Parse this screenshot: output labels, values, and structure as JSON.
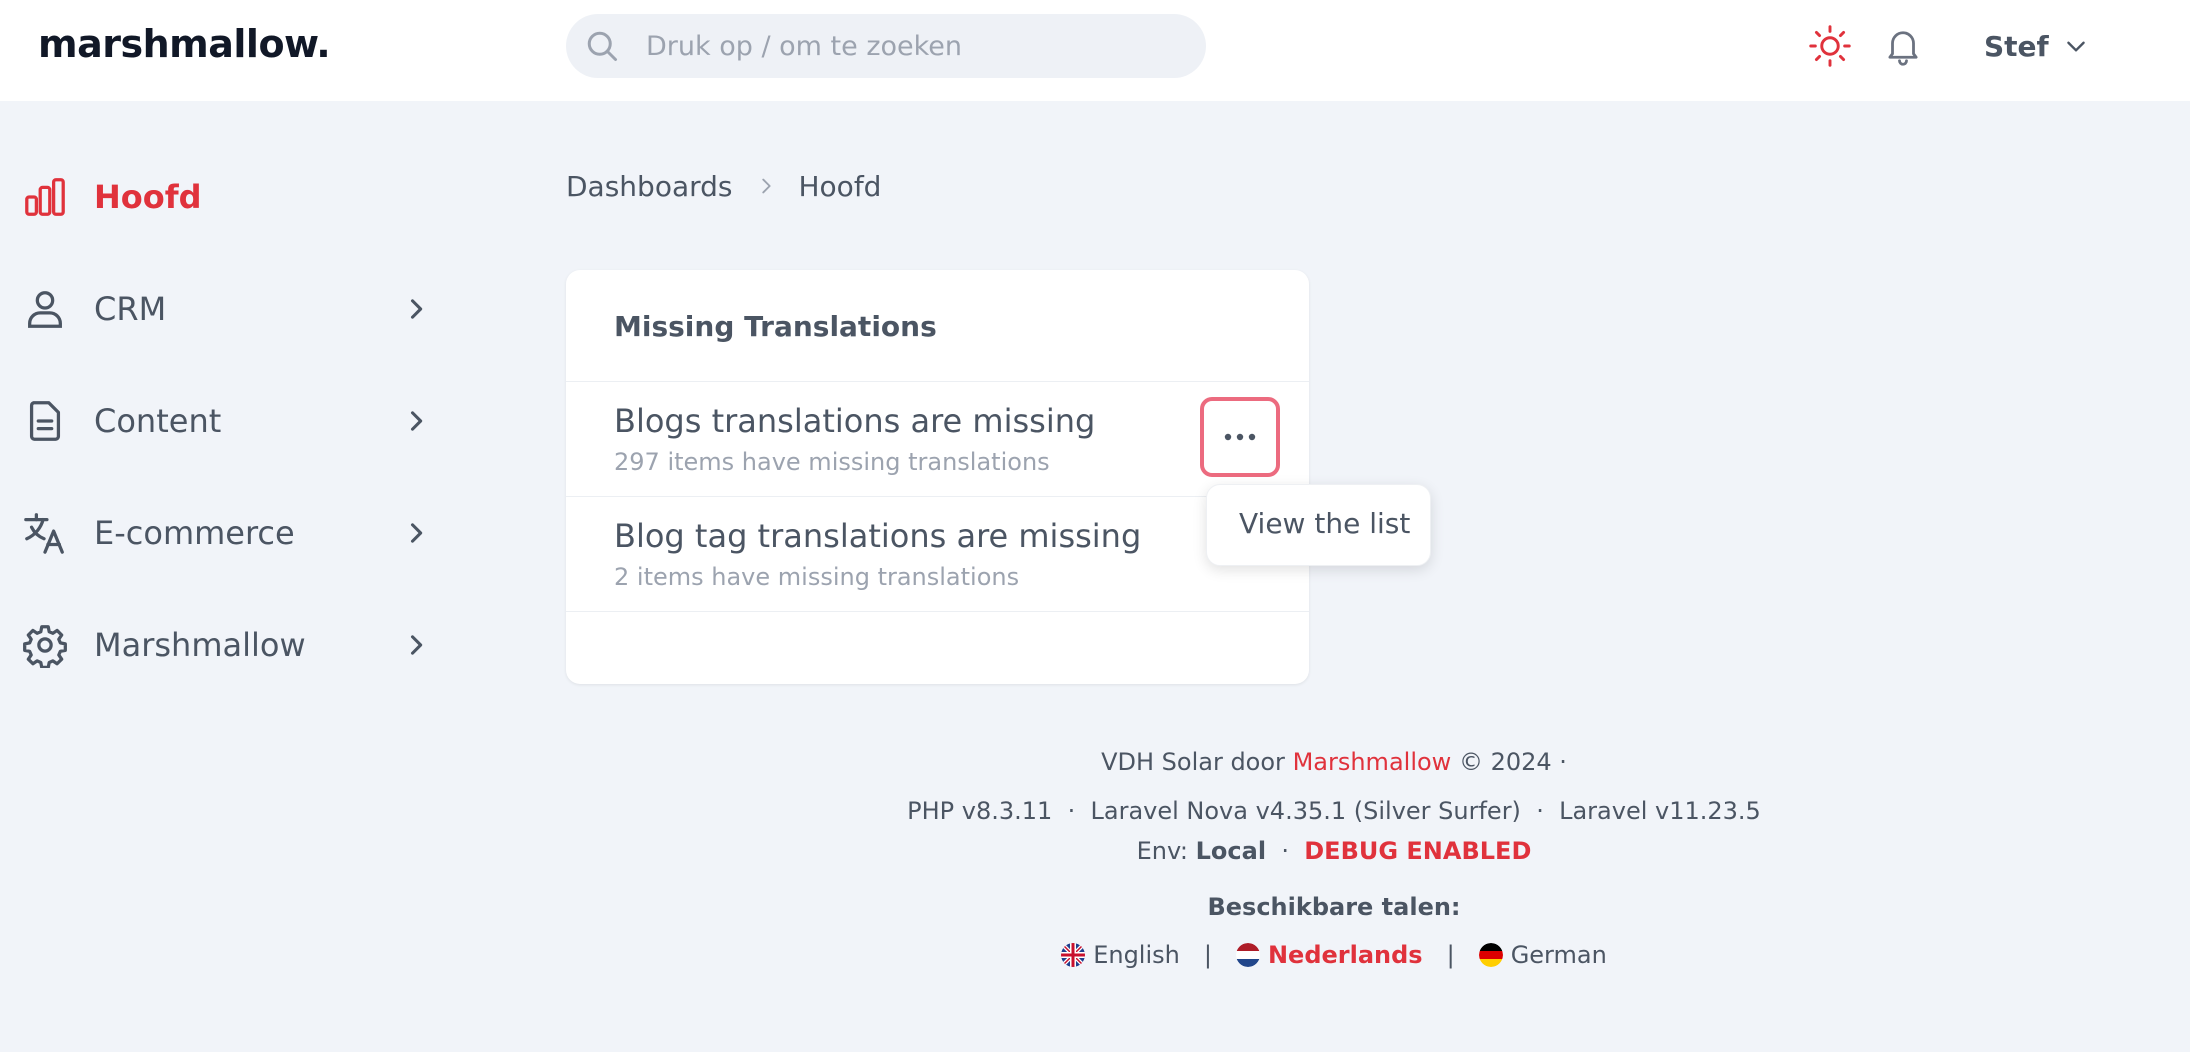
{
  "header": {
    "logo": "marshmallow.",
    "search_placeholder": "Druk op / om te zoeken",
    "user_name": "Stef"
  },
  "sidebar": {
    "items": [
      {
        "label": "Hoofd",
        "icon": "bar-chart-icon",
        "active": true
      },
      {
        "label": "CRM",
        "icon": "user-icon"
      },
      {
        "label": "Content",
        "icon": "document-icon"
      },
      {
        "label": "E-commerce",
        "icon": "translate-icon"
      },
      {
        "label": "Marshmallow",
        "icon": "gear-icon"
      }
    ]
  },
  "breadcrumb": {
    "parent": "Dashboards",
    "current": "Hoofd"
  },
  "card": {
    "title": "Missing Translations",
    "rows": [
      {
        "title": "Blogs translations are missing",
        "subtitle": "297 items have missing translations"
      },
      {
        "title": "Blog tag translations are missing",
        "subtitle": "2 items have missing translations"
      }
    ],
    "dropdown_item": "View the list"
  },
  "footer": {
    "line1_prefix": "VDH Solar door",
    "line1_link": "Marshmallow",
    "line1_suffix": "© 2024 ·",
    "php": "PHP v8.3.11",
    "nova": "Laravel Nova v4.35.1 (Silver Surfer)",
    "laravel": "Laravel v11.23.5",
    "env_label": "Env:",
    "env_value": "Local",
    "debug": "DEBUG ENABLED",
    "langs_title": "Beschikbare talen:",
    "languages": [
      {
        "label": "English",
        "flag": "uk-flag-icon"
      },
      {
        "label": "Nederlands",
        "flag": "nl-flag-icon",
        "active": true
      },
      {
        "label": "German",
        "flag": "de-flag-icon"
      }
    ],
    "separator": "|",
    "dot": "·"
  },
  "colors": {
    "accent": "#e0323c",
    "background": "#f1f4f9",
    "focus_ring": "#ec6b7f"
  }
}
